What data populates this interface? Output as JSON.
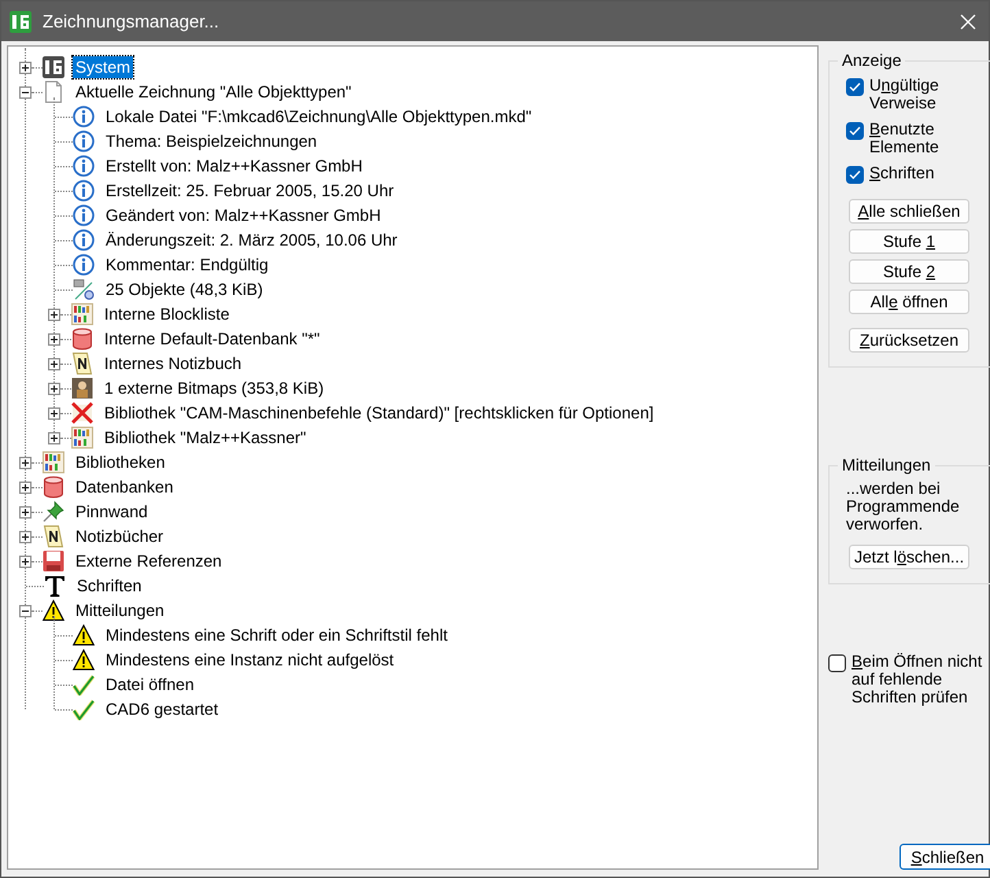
{
  "window": {
    "title": "Zeichnungsmanager..."
  },
  "tree": [
    {
      "label": "System",
      "kind": "cad",
      "expanded": false,
      "selected": true
    },
    {
      "label": "Aktuelle Zeichnung \"Alle Objekttypen\"",
      "kind": "document",
      "expanded": true,
      "selected": false,
      "children": [
        {
          "label": "Lokale Datei \"F:\\mkcad6\\Zeichnung\\Alle Objekttypen.mkd\"",
          "kind": "info",
          "selected": false
        },
        {
          "label": "Thema: Beispielzeichnungen",
          "kind": "info",
          "selected": false
        },
        {
          "label": "Erstellt von: Malz++Kassner GmbH",
          "kind": "info",
          "selected": false
        },
        {
          "label": "Erstellzeit: 25. Februar 2005, 15.20 Uhr",
          "kind": "info",
          "selected": false
        },
        {
          "label": "Geändert von: Malz++Kassner GmbH",
          "kind": "info",
          "selected": false
        },
        {
          "label": "Änderungszeit: 2. März 2005, 10.06 Uhr",
          "kind": "info",
          "selected": false
        },
        {
          "label": "Kommentar: Endgültig",
          "kind": "info",
          "selected": false
        },
        {
          "label": "25 Objekte (48,3 KiB)",
          "kind": "objects",
          "selected": false
        },
        {
          "label": "Interne Blockliste",
          "kind": "books",
          "expanded": false,
          "selected": false
        },
        {
          "label": "Interne Default-Datenbank \"*\"",
          "kind": "database",
          "expanded": false,
          "selected": false
        },
        {
          "label": "Internes Notizbuch",
          "kind": "notebook",
          "expanded": false,
          "selected": false
        },
        {
          "label": "1 externe Bitmaps (353,8 KiB)",
          "kind": "bitmap",
          "expanded": false,
          "selected": false
        },
        {
          "label": "Bibliothek \"CAM-Maschinenbefehle (Standard)\" [rechtsklicken für Optionen]",
          "kind": "missing",
          "expanded": false,
          "selected": false
        },
        {
          "label": "Bibliothek \"Malz++Kassner\"",
          "kind": "books",
          "expanded": false,
          "selected": false
        }
      ]
    },
    {
      "label": "Bibliotheken",
      "kind": "books",
      "expanded": false,
      "selected": false
    },
    {
      "label": "Datenbanken",
      "kind": "database",
      "expanded": false,
      "selected": false
    },
    {
      "label": "Pinnwand",
      "kind": "pin",
      "expanded": false,
      "selected": false
    },
    {
      "label": "Notizbücher",
      "kind": "notebook",
      "expanded": false,
      "selected": false
    },
    {
      "label": "Externe Referenzen",
      "kind": "external",
      "expanded": false,
      "selected": false
    },
    {
      "label": "Schriften",
      "kind": "font",
      "selected": false
    },
    {
      "label": "Mitteilungen",
      "kind": "warning",
      "expanded": true,
      "selected": false,
      "children": [
        {
          "label": "Mindestens eine Schrift oder ein Schriftstil fehlt",
          "kind": "warning",
          "selected": false
        },
        {
          "label": "Mindestens eine Instanz nicht aufgelöst",
          "kind": "warning",
          "selected": false
        },
        {
          "label": "Datei öffnen",
          "kind": "check",
          "selected": false
        },
        {
          "label": "CAD6 gestartet",
          "kind": "check",
          "selected": false
        }
      ]
    }
  ],
  "display_group": {
    "title": "Anzeige",
    "checkboxes": [
      {
        "label": {
          "pre": "U",
          "key": "n",
          "post": "gültige Verweise"
        },
        "checked": true
      },
      {
        "label": {
          "key": "B",
          "post": "enutzte Elemente"
        },
        "checked": true
      },
      {
        "label": {
          "key": "S",
          "post": "chriften"
        },
        "checked": true
      }
    ],
    "buttons": [
      {
        "key": "A",
        "post": "lle schließen"
      },
      {
        "pre": "Stufe ",
        "key": "1"
      },
      {
        "pre": "Stufe ",
        "key": "2"
      },
      {
        "pre": "All",
        "key": "e",
        "post": " öffnen"
      },
      {
        "key": "Z",
        "post": "urücksetzen"
      }
    ]
  },
  "messages_group": {
    "title": "Mitteilungen",
    "text": "...werden bei Programmende verworfen.",
    "button": {
      "pre": "Jetzt l",
      "key": "ö",
      "post": "schen..."
    }
  },
  "font_check": {
    "label": {
      "key": "B",
      "post": "eim Öffnen nicht auf fehlende Schriften prüfen"
    },
    "checked": false
  },
  "close_button": {
    "key": "S",
    "post": "chließen"
  }
}
